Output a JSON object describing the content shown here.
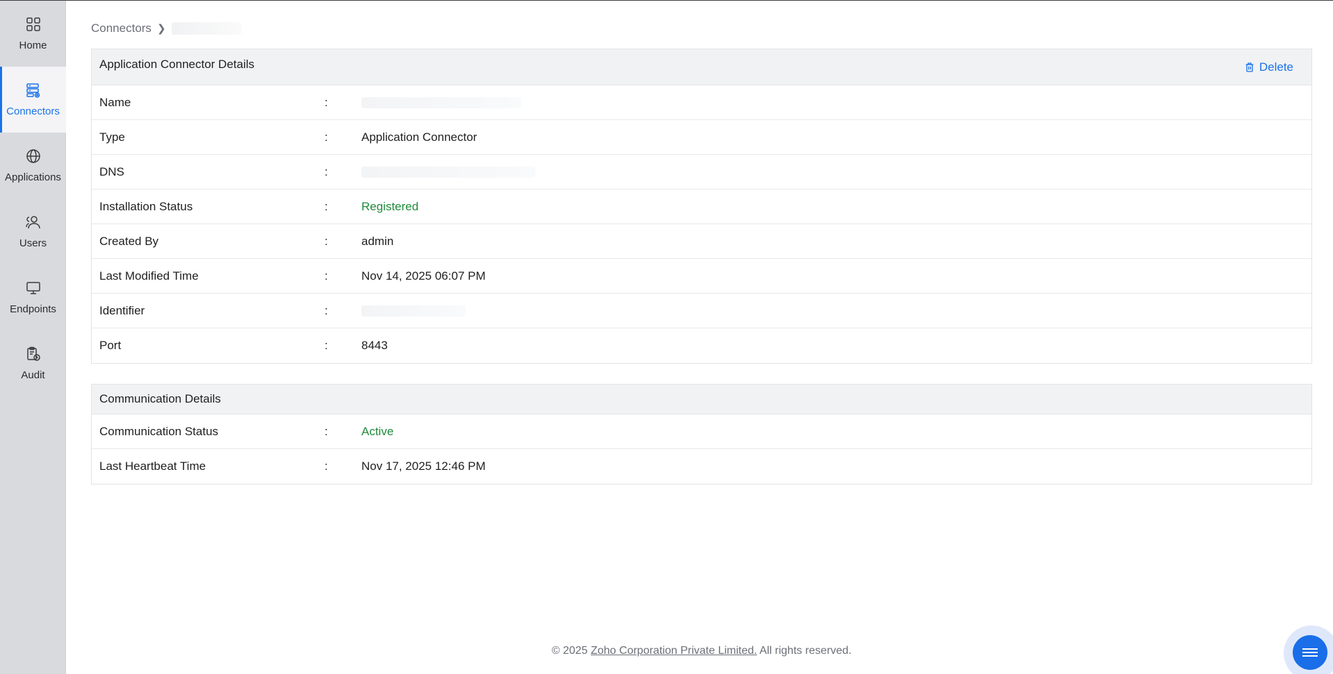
{
  "sidebar": {
    "items": [
      {
        "label": "Home",
        "icon": "grid-icon"
      },
      {
        "label": "Connectors",
        "icon": "server-gear-icon",
        "active": true
      },
      {
        "label": "Applications",
        "icon": "globe-icon"
      },
      {
        "label": "Users",
        "icon": "users-icon"
      },
      {
        "label": "Endpoints",
        "icon": "monitor-icon"
      },
      {
        "label": "Audit",
        "icon": "clipboard-clock-icon"
      }
    ]
  },
  "breadcrumb": {
    "root": "Connectors"
  },
  "connector_details": {
    "title": "Application Connector Details",
    "delete_label": "Delete",
    "rows": [
      {
        "label": "Name",
        "value": ""
      },
      {
        "label": "Type",
        "value": "Application Connector"
      },
      {
        "label": "DNS",
        "value": ""
      },
      {
        "label": "Installation Status",
        "value": "Registered"
      },
      {
        "label": "Created By",
        "value": "admin"
      },
      {
        "label": "Last Modified Time",
        "value": "Nov 14, 2025 06:07 PM"
      },
      {
        "label": "Identifier",
        "value": ""
      },
      {
        "label": "Port",
        "value": "8443"
      }
    ]
  },
  "communication_details": {
    "title": "Communication Details",
    "rows": [
      {
        "label": "Communication Status",
        "value": "Active"
      },
      {
        "label": "Last Heartbeat Time",
        "value": "Nov 17, 2025 12:46 PM"
      }
    ]
  },
  "separator": ":",
  "footer": {
    "prefix": "© 2025 ",
    "link": "Zoho Corporation Private Limited.",
    "suffix": " All rights reserved."
  },
  "colors": {
    "accent": "#1a73e8",
    "status_green": "#1f8a3b",
    "sidebar_bg": "#d9dade"
  }
}
